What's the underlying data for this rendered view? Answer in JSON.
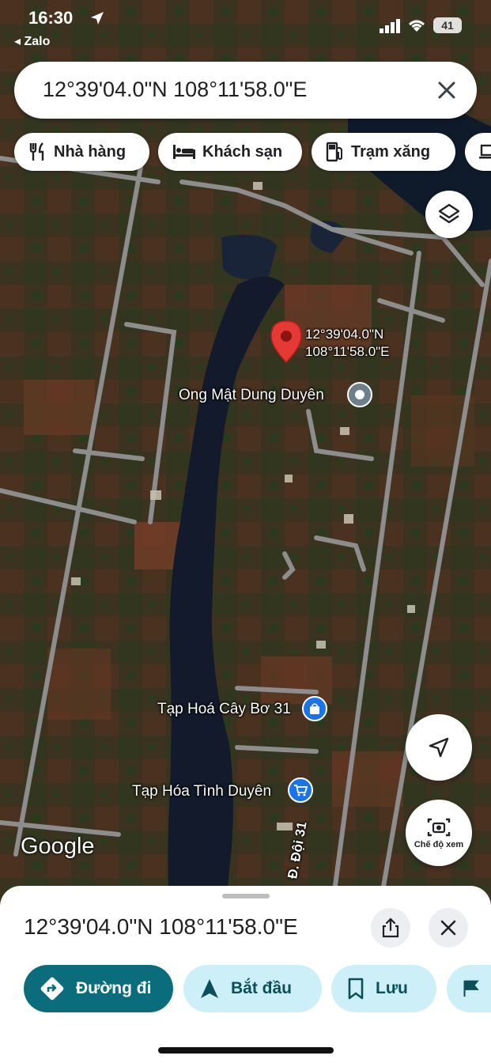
{
  "status_bar": {
    "time": "16:30",
    "back_app": "Zalo",
    "battery": "41"
  },
  "search": {
    "query": "12°39'04.0\"N 108°11'58.0\"E"
  },
  "chips": [
    {
      "label": "Nhà hàng",
      "icon": "fork-knife-icon"
    },
    {
      "label": "Khách sạn",
      "icon": "bed-icon"
    },
    {
      "label": "Trạm xăng",
      "icon": "gas-pump-icon"
    }
  ],
  "map": {
    "pin_label_line1": "12°39'04.0\"N",
    "pin_label_line2": "108°11'58.0\"E",
    "places": [
      {
        "name": "Ong Mật Dung Duyên",
        "icon": "place-dot-icon"
      },
      {
        "name": "Tạp Hoá Cây Bơ 31",
        "icon": "shopping-bag-icon"
      },
      {
        "name": "Tạp Hóa Tình Duyên",
        "icon": "shopping-cart-icon"
      }
    ],
    "road_label": "Đ. Đội 31",
    "watermark": "Google",
    "street_view_label": "Chế độ xem"
  },
  "sheet": {
    "title": "12°39'04.0\"N 108°11'58.0\"E",
    "actions": [
      {
        "label": "Đường đi",
        "icon": "directions-icon"
      },
      {
        "label": "Bắt đầu",
        "icon": "navigation-arrow-icon"
      },
      {
        "label": "Lưu",
        "icon": "bookmark-icon"
      }
    ]
  },
  "colors": {
    "primary": "#0b6d7b",
    "tonal": "#cdeff7",
    "pin": "#e53935",
    "poi_blue": "#1a73e8"
  }
}
